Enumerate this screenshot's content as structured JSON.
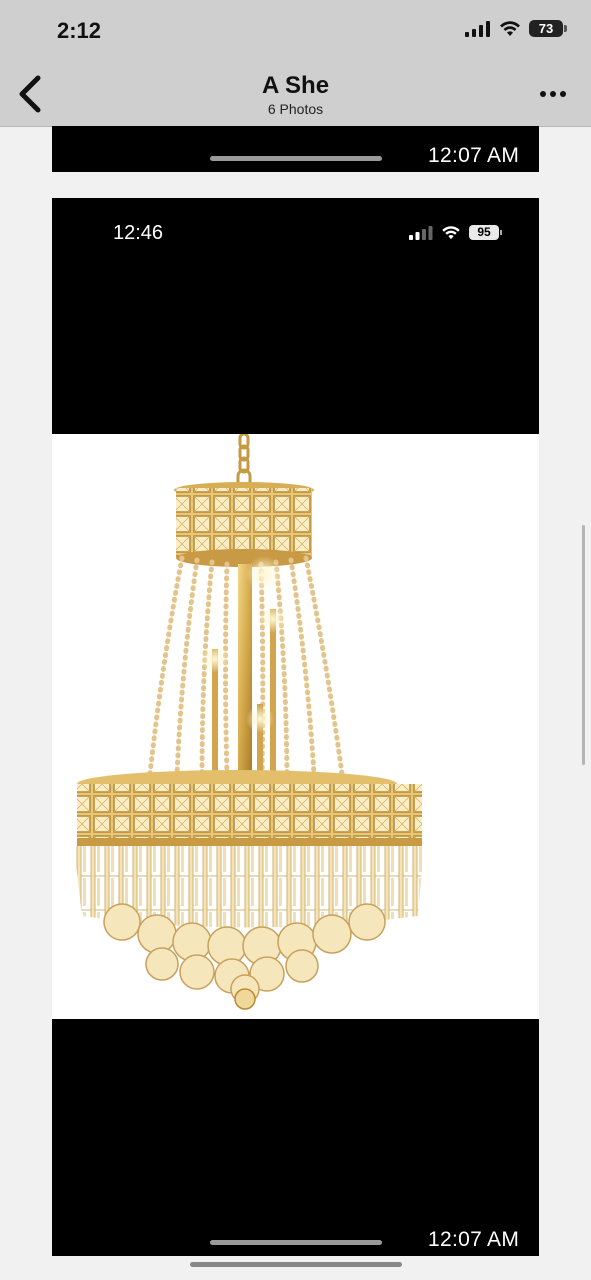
{
  "status_bar": {
    "time": "2:12",
    "battery": "73",
    "icons": [
      "signal-icon",
      "wifi-icon",
      "battery-icon"
    ]
  },
  "nav": {
    "title": "A She",
    "subtitle": "6 Photos",
    "icons": [
      "back-chevron-icon",
      "more-icon"
    ]
  },
  "photos": {
    "previous": {
      "timestamp": "12:07 AM"
    },
    "current": {
      "screenshot_status_time": "12:46",
      "screenshot_battery": "95",
      "timestamp": "12:07 AM"
    }
  },
  "colors": {
    "nav_background": "#cfcfcf",
    "photo_background": "#000000",
    "page_background": "#f1f1f1",
    "chandelier_gold": "#d4a94a"
  }
}
